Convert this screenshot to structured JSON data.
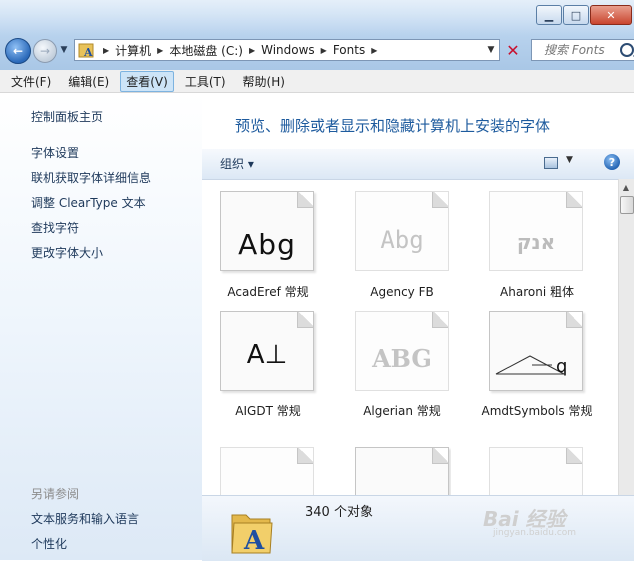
{
  "address": {
    "crumbs": [
      "计算机",
      "本地磁盘 (C:)",
      "Windows",
      "Fonts"
    ]
  },
  "search": {
    "placeholder": "搜索 Fonts"
  },
  "menubar": [
    "文件(F)",
    "编辑(E)",
    "查看(V)",
    "工具(T)",
    "帮助(H)"
  ],
  "left_pane": {
    "home": "控制面板主页",
    "links": [
      "字体设置",
      "联机获取字体详细信息",
      "调整 ClearType 文本",
      "查找字符",
      "更改字体大小"
    ],
    "see_also_title": "另请参阅",
    "see_also": [
      "文本服务和输入语言",
      "个性化"
    ]
  },
  "content": {
    "heading": "预览、删除或者显示和隐藏计算机上安装的字体",
    "organize": "组织 ▾",
    "fonts": [
      {
        "sample": "Abg",
        "name": "AcadEref 常规"
      },
      {
        "sample": "Abg",
        "name": "Agency FB"
      },
      {
        "sample": "אנק",
        "name": "Aharoni 粗体"
      },
      {
        "sample": "A⊥",
        "name": "AIGDT 常规"
      },
      {
        "sample": "ABG",
        "name": "Algerian 常规"
      },
      {
        "sample": "q",
        "name": "AmdtSymbols 常规"
      }
    ]
  },
  "details": {
    "count": "340 个对象"
  },
  "watermark": {
    "line1": "Bai 经验",
    "line2": "jingyan.baidu.com"
  }
}
